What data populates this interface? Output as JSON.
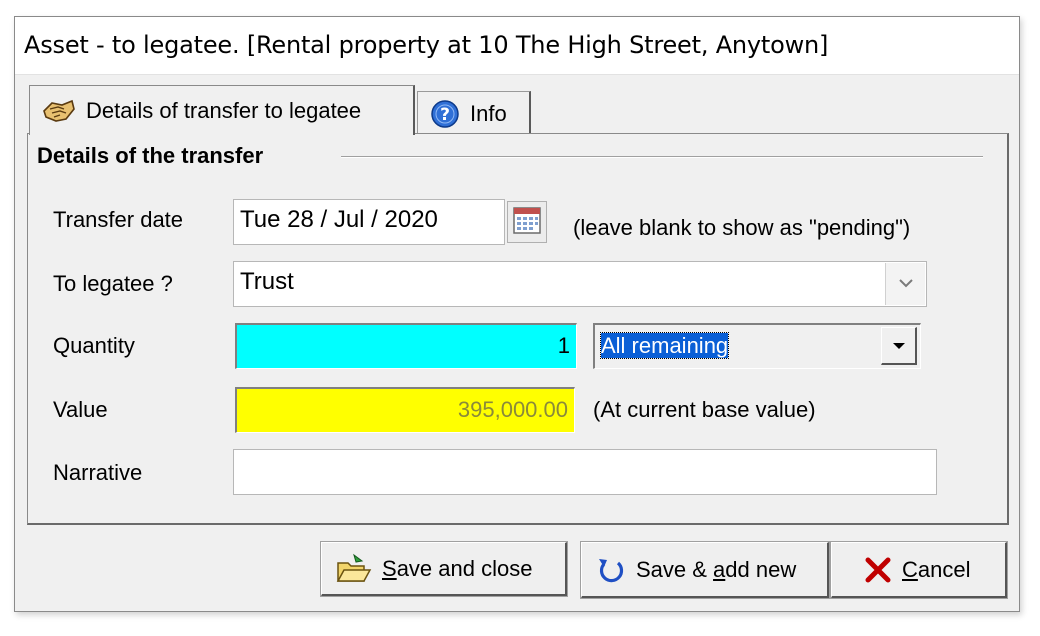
{
  "window": {
    "title": "Asset - to legatee. [Rental property at 10 The High Street, Anytown]"
  },
  "tabs": [
    {
      "label": "Details of transfer to legatee",
      "icon": "handshake-icon",
      "active": true
    },
    {
      "label": "Info",
      "icon": "help-icon",
      "active": false
    }
  ],
  "group": {
    "title": "Details of the transfer"
  },
  "form": {
    "transfer_date": {
      "label": "Transfer date",
      "value": "Tue  28 / Jul / 2020",
      "hint": "(leave blank to show as \"pending\")",
      "icon": "calendar-icon"
    },
    "legatee": {
      "label": "To legatee ?",
      "value": "Trust"
    },
    "quantity": {
      "label": "Quantity",
      "value": "1",
      "mode": "All remaining",
      "color": "#00ffff"
    },
    "value": {
      "label": "Value",
      "amount": "395,000.00",
      "note": "(At current base value)",
      "color": "#ffff00"
    },
    "narrative": {
      "label": "Narrative",
      "value": ""
    }
  },
  "buttons": {
    "save_close": {
      "prefix": "S",
      "rest": "ave and close",
      "icon": "folder-open-icon"
    },
    "save_add": {
      "before": "Save & ",
      "accel": "a",
      "after": "dd new",
      "icon": "refresh-icon"
    },
    "cancel": {
      "prefix": "C",
      "rest": "ancel",
      "icon": "x-icon",
      "icon_color": "#c00000"
    }
  }
}
